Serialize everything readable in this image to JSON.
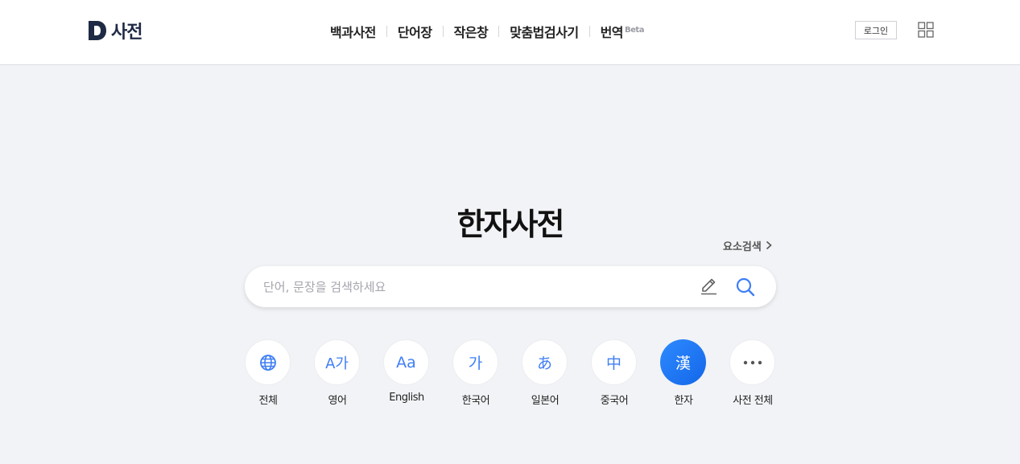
{
  "brand": {
    "name": "사전"
  },
  "nav": [
    {
      "label": "백과사전"
    },
    {
      "label": "단어장"
    },
    {
      "label": "작은창"
    },
    {
      "label": "맞춤법검사기"
    },
    {
      "label": "번역",
      "badge": "Beta"
    }
  ],
  "header": {
    "login_label": "로그인"
  },
  "page": {
    "title": "한자사전",
    "advanced_label": "요소검색"
  },
  "search": {
    "value": "",
    "placeholder": "단어, 문장을 검색하세요"
  },
  "categories": [
    {
      "icon": "globe-icon",
      "glyph": "",
      "label": "전체",
      "active": false
    },
    {
      "icon": "english-dict-icon",
      "glyph": "A가",
      "label": "영어",
      "active": false
    },
    {
      "icon": "english-english-icon",
      "glyph": "Aa",
      "label": "English",
      "active": false
    },
    {
      "icon": "korean-dict-icon",
      "glyph": "가",
      "label": "한국어",
      "active": false
    },
    {
      "icon": "japanese-dict-icon",
      "glyph": "あ",
      "label": "일본어",
      "active": false
    },
    {
      "icon": "chinese-dict-icon",
      "glyph": "中",
      "label": "중국어",
      "active": false
    },
    {
      "icon": "hanja-dict-icon",
      "glyph": "漢",
      "label": "한자",
      "active": true
    },
    {
      "icon": "more-icon",
      "glyph": "",
      "label": "사전 전체",
      "active": false
    }
  ],
  "colors": {
    "accent": "#1f7bff",
    "icon_blue": "#3f7ef6",
    "background": "#f2f3f6",
    "brand_dark": "#1f2a44"
  }
}
